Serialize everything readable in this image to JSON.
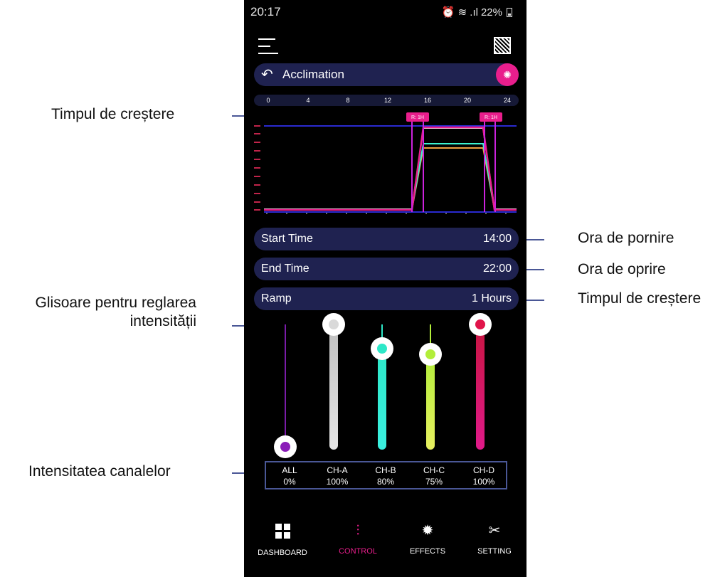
{
  "annotations": {
    "rise_time_top": "Timpul de creștere",
    "start_time": "Ora de pornire",
    "end_time": "Ora de oprire",
    "rise_time_ramp": "Timpul de creștere",
    "sliders_line1": "Glisoare pentru reglarea",
    "sliders_line2": "intensității",
    "channel_intensity": "Intensitatea canalelor"
  },
  "status_bar": {
    "time": "20:17",
    "icons": "⏰ ≋ .ıl",
    "battery": "22%"
  },
  "header": {
    "menu_icon": "hamburger-icon",
    "qr_icon": "qr-code-icon"
  },
  "title_bar": {
    "back_icon": "↶",
    "title": "Acclimation",
    "coral_icon": "coral-icon"
  },
  "time_axis": {
    "ticks": [
      "0",
      "4",
      "8",
      "12",
      "16",
      "20",
      "24"
    ]
  },
  "chart": {
    "ramp_tag_left": "R: 1H",
    "ramp_tag_right": "R: 1H",
    "colors": {
      "ch_a": "#e6e6e6",
      "ch_b": "#3cf0d0",
      "ch_c": "#b8f040",
      "ch_d": "#e91e63",
      "all": "#9b27c7",
      "axis": "#2a2ad0"
    }
  },
  "settings": {
    "start_time_label": "Start Time",
    "start_time_value": "14:00",
    "end_time_label": "End Time",
    "end_time_value": "22:00",
    "ramp_label": "Ramp",
    "ramp_value": "1 Hours"
  },
  "channels": [
    {
      "name": "ALL",
      "value": "0%",
      "level": 0,
      "color": "#8a1cb8"
    },
    {
      "name": "CH-A",
      "value": "100%",
      "level": 1.0,
      "color": "#d9d9d9"
    },
    {
      "name": "CH-B",
      "value": "80%",
      "level": 0.8,
      "color": "#2de8c8"
    },
    {
      "name": "CH-C",
      "value": "75%",
      "level": 0.75,
      "color": "#b2ee3a"
    },
    {
      "name": "CH-D",
      "value": "100%",
      "level": 1.0,
      "color": "#e0144a"
    }
  ],
  "bottom_nav": [
    {
      "label": "DASHBOARD",
      "icon": "dashboard-grid-icon",
      "active": false
    },
    {
      "label": "CONTROL",
      "icon": "sliders-icon",
      "active": true
    },
    {
      "label": "EFFECTS",
      "icon": "effects-icon",
      "active": false
    },
    {
      "label": "SETTING",
      "icon": "tools-icon",
      "active": false
    }
  ]
}
